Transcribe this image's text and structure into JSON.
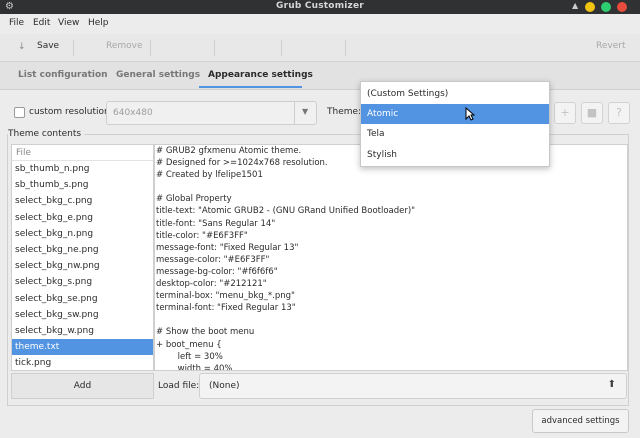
{
  "window": {
    "title": "Grub Customizer",
    "controls": [
      "up-arrow-icon",
      "minimize",
      "maximize",
      "close"
    ],
    "colors": {
      "minimize": "#f1c40f",
      "maximize": "#2ecc71",
      "close": "#e74c3c"
    }
  },
  "menubar": {
    "items": [
      "File",
      "Edit",
      "View",
      "Help"
    ]
  },
  "toolbar": {
    "save_label": "Save",
    "remove_label": "Remove",
    "revert_label": "Revert"
  },
  "tabs": [
    {
      "label": "List configuration"
    },
    {
      "label": "General settings"
    },
    {
      "label": "Appearance settings"
    }
  ],
  "appearance": {
    "custom_resolution_label": "custom resolution:",
    "resolution_value": "640x480",
    "theme_label": "Theme:",
    "theme_contents_label": "Theme contents",
    "file_header": "File",
    "files": [
      "sb_thumb_n.png",
      "sb_thumb_s.png",
      "select_bkg_c.png",
      "select_bkg_e.png",
      "select_bkg_n.png",
      "select_bkg_ne.png",
      "select_bkg_nw.png",
      "select_bkg_s.png",
      "select_bkg_se.png",
      "select_bkg_sw.png",
      "select_bkg_w.png",
      "theme.txt",
      "tick.png"
    ],
    "selected_file": "theme.txt",
    "editor_lines": [
      "# GRUB2 gfxmenu Atomic theme.",
      "# Designed for >=1024x768 resolution.",
      "# Created by lfelipe1501",
      "",
      "# Global Property",
      "title-text: \"Atomic GRUB2 - (GNU GRand Unified Bootloader)\"",
      "title-font: \"Sans Regular 14\"",
      "title-color: \"#E6F3FF\"",
      "message-font: \"Fixed Regular 13\"",
      "message-color: \"#E6F3FF\"",
      "message-bg-color: \"#f6f6f6\"",
      "desktop-color: \"#212121\"",
      "terminal-box: \"menu_bkg_*.png\"",
      "terminal-font: \"Fixed Regular 13\"",
      "",
      "# Show the boot menu",
      "+ boot_menu {",
      "        left = 30%",
      "        width = 40%"
    ],
    "add_label": "Add",
    "load_file_label": "Load file:",
    "load_file_value": "(None)",
    "advanced_label": "advanced settings"
  },
  "theme_dropdown": {
    "options": [
      "(Custom Settings)",
      "Atomic",
      "Tela",
      "Stylish"
    ],
    "highlighted": "Atomic"
  },
  "accent_color": "#5294e2"
}
